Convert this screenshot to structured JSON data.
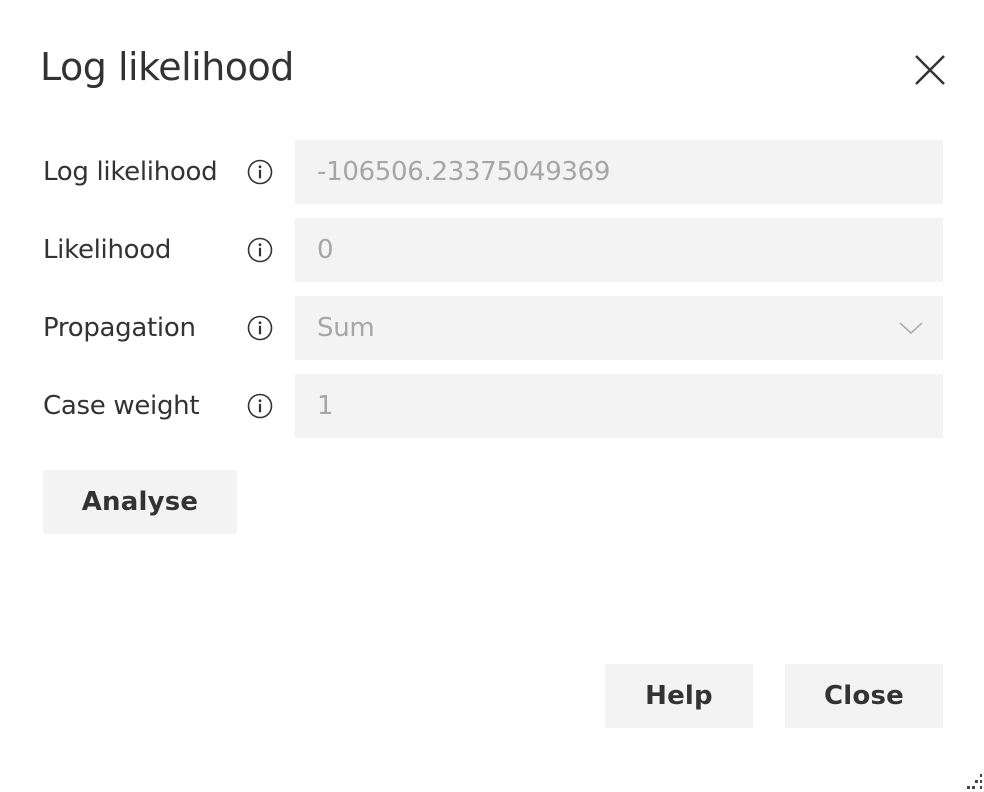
{
  "dialog": {
    "title": "Log likelihood",
    "close_icon": "close-icon"
  },
  "fields": [
    {
      "label": "Log likelihood",
      "value": "-106506.23375049369",
      "type": "text",
      "info_icon": "info-icon"
    },
    {
      "label": "Likelihood",
      "value": "0",
      "type": "text",
      "info_icon": "info-icon"
    },
    {
      "label": "Propagation",
      "value": "Sum",
      "type": "select",
      "info_icon": "info-icon",
      "dropdown_icon": "chevron-down-icon"
    },
    {
      "label": "Case weight",
      "value": "1",
      "type": "text",
      "info_icon": "info-icon"
    }
  ],
  "buttons": {
    "analyse": "Analyse",
    "help": "Help",
    "close": "Close"
  },
  "colors": {
    "text": "#333333",
    "field_background": "#f3f3f3",
    "field_text": "#a6a6a6",
    "button_background": "#f3f3f3"
  }
}
